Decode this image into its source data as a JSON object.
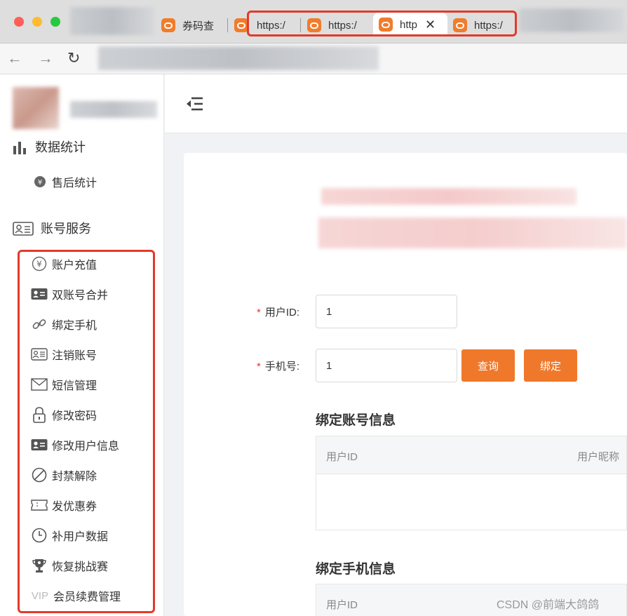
{
  "browser": {
    "tabs": [
      {
        "label": "券码查"
      },
      {
        "label": "https:/"
      },
      {
        "label": "https:/"
      },
      {
        "label": "http",
        "active": true
      },
      {
        "label": "https:/"
      }
    ],
    "close_glyph": "✕",
    "nav": {
      "back": "←",
      "forward": "→",
      "reload": "↻"
    }
  },
  "sidebar": {
    "groups": [
      {
        "title": "数据统计",
        "icon": "bar-chart-icon",
        "items": [
          {
            "label": "售后统计",
            "icon": "yen-refund-icon"
          }
        ]
      },
      {
        "title": "账号服务",
        "icon": "id-card-icon",
        "items": [
          {
            "label": "账户充值",
            "icon": "yen-circle-icon"
          },
          {
            "label": "双账号合并",
            "icon": "contact-card-icon"
          },
          {
            "label": "绑定手机",
            "icon": "link-icon"
          },
          {
            "label": "注销账号",
            "icon": "id-card-outline-icon"
          },
          {
            "label": "短信管理",
            "icon": "envelope-icon"
          },
          {
            "label": "修改密码",
            "icon": "lock-icon"
          },
          {
            "label": "修改用户信息",
            "icon": "contact-card-icon"
          },
          {
            "label": "封禁解除",
            "icon": "ban-icon"
          },
          {
            "label": "发优惠券",
            "icon": "ticket-icon"
          },
          {
            "label": "补用户数据",
            "icon": "clock-icon"
          },
          {
            "label": "恢复挑战赛",
            "icon": "trophy-icon"
          },
          {
            "label": "会员续费管理",
            "icon": "vip-icon"
          }
        ]
      }
    ],
    "vip_text": "VIP"
  },
  "form": {
    "user_id_label": "用户ID:",
    "user_id_value": "1",
    "phone_label": "手机号:",
    "phone_value": "1",
    "required_mark": "*",
    "query_button": "查询",
    "bind_button": "绑定"
  },
  "sections": {
    "account_info_title": "绑定账号信息",
    "account_table_headers": [
      "用户ID",
      "用户昵称"
    ],
    "phone_info_title": "绑定手机信息",
    "phone_table_headers": [
      "用户ID"
    ]
  },
  "watermark": "CSDN @前端大鸽鸽",
  "colors": {
    "accent": "#f0782b",
    "highlight": "#e23a2a",
    "required": "#e23a2a"
  }
}
